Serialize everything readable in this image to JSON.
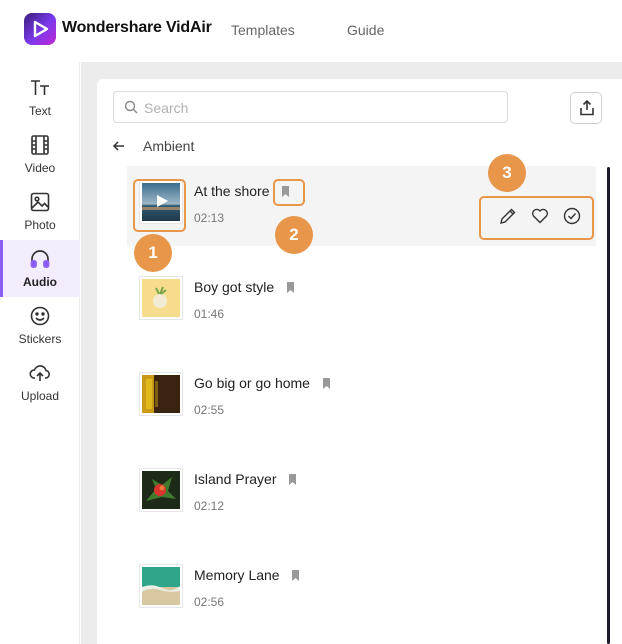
{
  "app": {
    "brand": "Wondershare VidAir",
    "nav": [
      {
        "label": "Templates"
      },
      {
        "label": "Guide"
      }
    ]
  },
  "sidebar": {
    "items": [
      {
        "label": "Text",
        "icon": "text-icon"
      },
      {
        "label": "Video",
        "icon": "film-icon"
      },
      {
        "label": "Photo",
        "icon": "image-icon"
      },
      {
        "label": "Audio",
        "icon": "headphones-icon",
        "active": true
      },
      {
        "label": "Stickers",
        "icon": "smiley-icon"
      },
      {
        "label": "Upload",
        "icon": "cloud-upload-icon"
      }
    ]
  },
  "search": {
    "placeholder": "Search",
    "value": ""
  },
  "breadcrumb": {
    "label": "Ambient"
  },
  "tracks": [
    {
      "title": "At the shore",
      "duration": "02:13"
    },
    {
      "title": "Boy got style",
      "duration": "01:46"
    },
    {
      "title": "Go big or go home",
      "duration": "02:55"
    },
    {
      "title": "Island Prayer",
      "duration": "02:12"
    },
    {
      "title": "Memory Lane",
      "duration": "02:56"
    }
  ],
  "annotations": [
    {
      "label": "1"
    },
    {
      "label": "2"
    },
    {
      "label": "3"
    }
  ],
  "colors": {
    "accent": "#8b5cf6",
    "annotation": "#e8974a",
    "active_bg": "#f3ecfd"
  }
}
